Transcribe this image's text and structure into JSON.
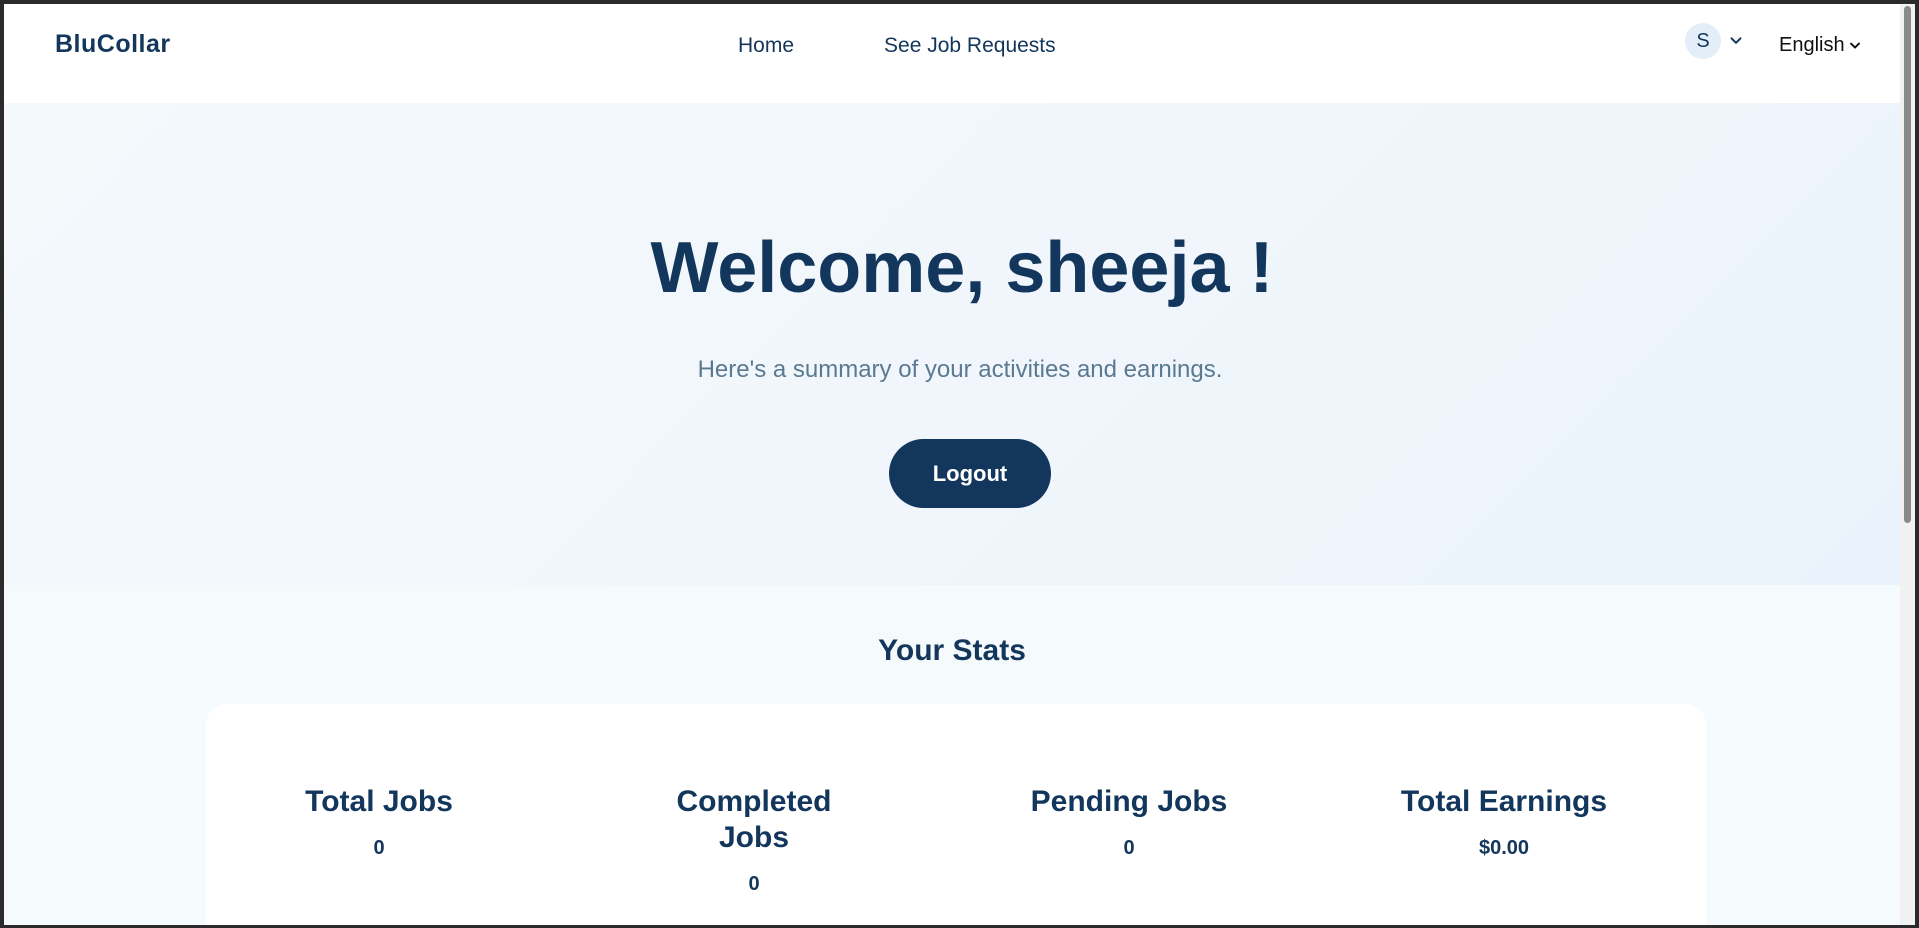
{
  "navbar": {
    "brand": "BluCollar",
    "links": [
      "Home",
      "See Job Requests"
    ],
    "avatar_initial": "S",
    "language": "English"
  },
  "hero": {
    "title": "Welcome, sheeja !",
    "subtitle": "Here's a summary of your activities and earnings.",
    "logout_label": "Logout"
  },
  "stats": {
    "title": "Your Stats",
    "items": [
      {
        "label": "Total Jobs",
        "value": "0"
      },
      {
        "label": "Completed Jobs",
        "value": "0"
      },
      {
        "label": "Pending Jobs",
        "value": "0"
      },
      {
        "label": "Total Earnings",
        "value": "$0.00"
      }
    ]
  },
  "colors": {
    "primary": "#13365c",
    "background": "#f5fafd",
    "subtitle": "#5a7a92",
    "avatar_bg": "#e4eef8"
  }
}
